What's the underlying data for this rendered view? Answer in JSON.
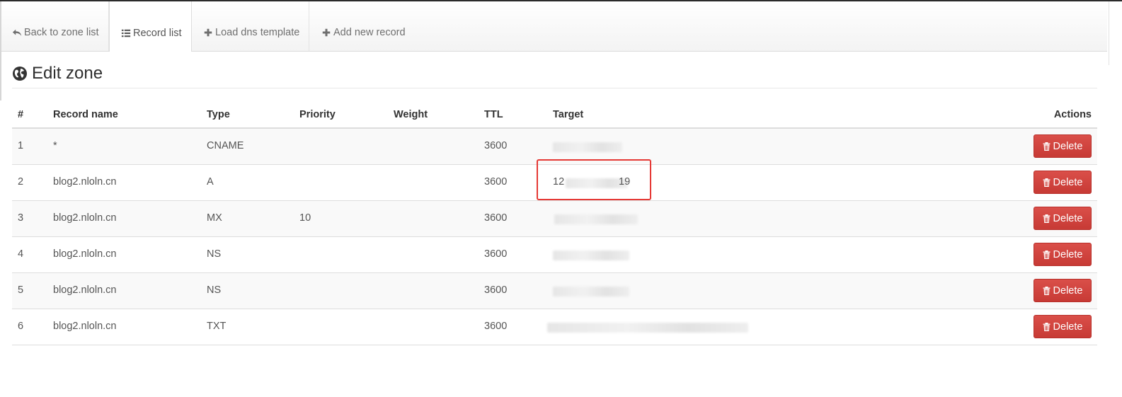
{
  "nav": {
    "tabs": [
      {
        "label": "Back to zone list",
        "icon": "reply-icon"
      },
      {
        "label": "Record list",
        "icon": "list-icon",
        "active": true
      },
      {
        "label": "Load dns template",
        "icon": "plus-icon"
      },
      {
        "label": "Add new record",
        "icon": "plus-icon"
      }
    ]
  },
  "page": {
    "title": "Edit zone",
    "title_icon": "globe-icon"
  },
  "table": {
    "headers": {
      "num": "#",
      "name": "Record name",
      "type": "Type",
      "priority": "Priority",
      "weight": "Weight",
      "ttl": "TTL",
      "target": "Target",
      "actions": "Actions"
    },
    "rows": [
      {
        "num": "1",
        "name": "*",
        "type": "CNAME",
        "priority": "",
        "weight": "",
        "ttl": "3600",
        "target": "",
        "action": "Delete"
      },
      {
        "num": "2",
        "name": "blog2.nloln.cn",
        "type": "A",
        "priority": "",
        "weight": "",
        "ttl": "3600",
        "target_prefix": "12",
        "target_suffix": "19",
        "action": "Delete"
      },
      {
        "num": "3",
        "name": "blog2.nloln.cn",
        "type": "MX",
        "priority": "10",
        "weight": "",
        "ttl": "3600",
        "target": "",
        "action": "Delete"
      },
      {
        "num": "4",
        "name": "blog2.nloln.cn",
        "type": "NS",
        "priority": "",
        "weight": "",
        "ttl": "3600",
        "target": "",
        "action": "Delete"
      },
      {
        "num": "5",
        "name": "blog2.nloln.cn",
        "type": "NS",
        "priority": "",
        "weight": "",
        "ttl": "3600",
        "target": "",
        "action": "Delete"
      },
      {
        "num": "6",
        "name": "blog2.nloln.cn",
        "type": "TXT",
        "priority": "",
        "weight": "",
        "ttl": "3600",
        "target": "",
        "action": "Delete"
      }
    ]
  },
  "colors": {
    "delete_button": "#d9534f",
    "highlight_box": "#e53935"
  }
}
